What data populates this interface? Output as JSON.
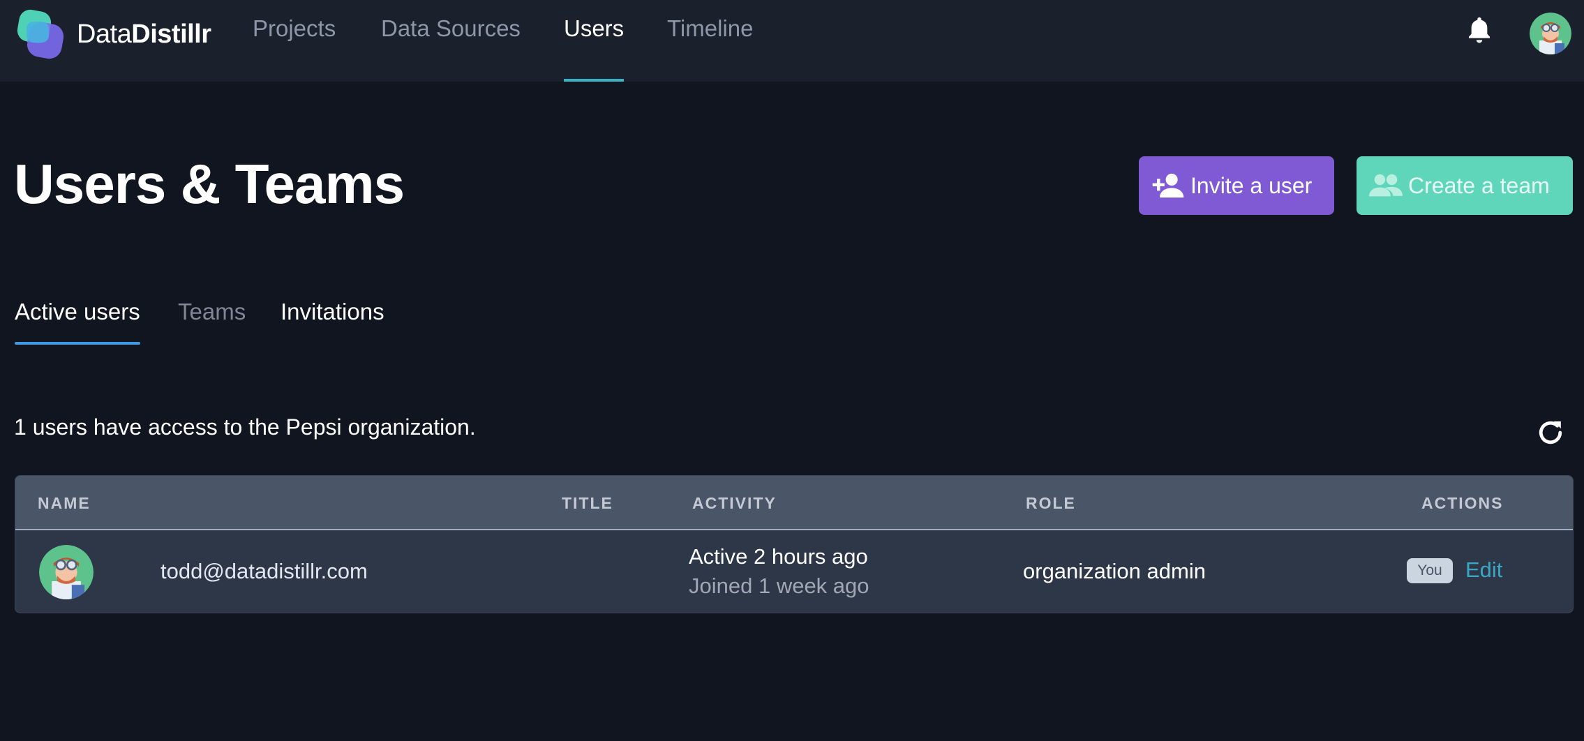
{
  "app": {
    "logo_regular": "Data",
    "logo_bold": "Distillr"
  },
  "nav": {
    "items": [
      {
        "label": "Projects",
        "active": false
      },
      {
        "label": "Data Sources",
        "active": false
      },
      {
        "label": "Users",
        "active": true
      },
      {
        "label": "Timeline",
        "active": false
      }
    ]
  },
  "page": {
    "title": "Users & Teams",
    "invite_label": "Invite a user",
    "create_team_label": "Create a team"
  },
  "tabs": [
    {
      "label": "Active users",
      "active": true
    },
    {
      "label": "Teams",
      "active": false
    },
    {
      "label": "Invitations",
      "active": false
    }
  ],
  "summary": "1 users have access to the Pepsi organization.",
  "table": {
    "columns": [
      "NAME",
      "TITLE",
      "ACTIVITY",
      "ROLE",
      "ACTIONS"
    ],
    "rows": [
      {
        "email": "todd@datadistillr.com",
        "title": "",
        "activity_active": "Active 2 hours ago",
        "activity_joined": "Joined 1 week ago",
        "role": "organization admin",
        "badge": "You",
        "action": "Edit"
      }
    ]
  },
  "colors": {
    "background": "#11151f",
    "topbar": "#1a202c",
    "invite_button": "#805ad5",
    "create_team_button": "#5fd6ba",
    "active_tab_underline": "#4299e1",
    "nav_underline": "#38b2c4",
    "edit_link": "#3ba7c4"
  },
  "icons": [
    "logo-icon",
    "bell-icon",
    "user-avatar",
    "add-user-icon",
    "team-icon",
    "refresh-icon"
  ]
}
